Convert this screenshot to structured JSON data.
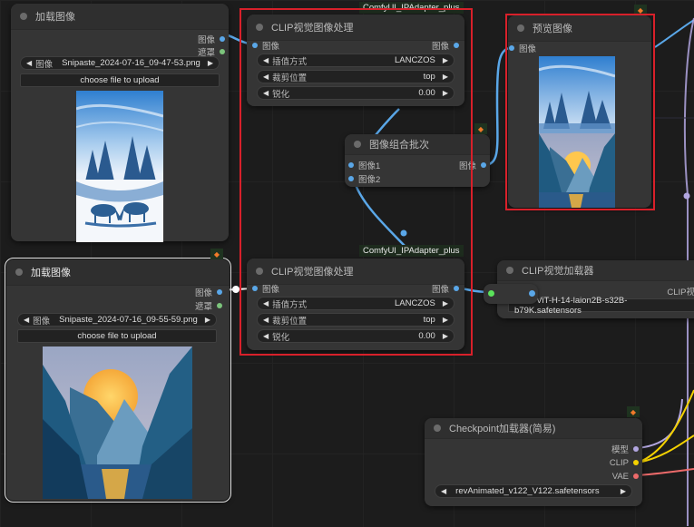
{
  "group_label": "ComfyUI_IPAdapter_plus",
  "nodes": {
    "load_image_1": {
      "title": "加载图像",
      "outputs": [
        "图像",
        "遮罩"
      ],
      "file_widget": {
        "label": "图像",
        "value": "Snipaste_2024-07-16_09-47-53.png"
      },
      "upload_button": "choose file to upload",
      "preview": "winter forest with two deer (blue watercolor)"
    },
    "load_image_2": {
      "title": "加载图像",
      "outputs": [
        "图像",
        "遮罩"
      ],
      "file_widget": {
        "label": "图像",
        "value": "Snipaste_2024-07-16_09-55-59.png"
      },
      "upload_button": "choose file to upload",
      "preview": "mountain river at sunset (blue and yellow)"
    },
    "clip_prep_1": {
      "title": "CLIP视觉图像处理",
      "pack": "ComfyUI_IPAdapter_plus",
      "input": "图像",
      "output": "图像",
      "widgets": [
        {
          "label": "插值方式",
          "value": "LANCZOS"
        },
        {
          "label": "裁剪位置",
          "value": "top"
        },
        {
          "label": "锐化",
          "value": "0.00"
        }
      ]
    },
    "clip_prep_2": {
      "title": "CLIP视觉图像处理",
      "pack": "ComfyUI_IPAdapter_plus",
      "input": "图像",
      "output": "图像",
      "widgets": [
        {
          "label": "插值方式",
          "value": "LANCZOS"
        },
        {
          "label": "裁剪位置",
          "value": "top"
        },
        {
          "label": "锐化",
          "value": "0.00"
        }
      ]
    },
    "image_batch": {
      "title": "图像组合批次",
      "inputs": [
        "图像1",
        "图像2"
      ],
      "output": "图像"
    },
    "preview_image": {
      "title": "预览图像",
      "input": "图像",
      "preview": "combined batch: forest sky + mountain sunset"
    },
    "clip_vision_loader": {
      "title": "CLIP视觉加载器",
      "output": "CLIP视",
      "widget_value": "CLIP-ViT-H-14-laion2B-s32B-b79K.safetensors"
    },
    "checkpoint_loader": {
      "title": "Checkpoint加载器(简易)",
      "outputs": [
        "模型",
        "CLIP",
        "VAE"
      ],
      "widget_value": "revAnimated_v122_V122.safetensors"
    }
  },
  "colors": {
    "image_wire": "#5aa7e8",
    "mask_pin": "#7cc47c",
    "model_wire": "#b2a6e0",
    "clip_wire": "#f4d100",
    "vae_wire": "#ec6a6a",
    "highlight_box": "#d8202a",
    "clip_vision_pin": "#5be35b"
  }
}
